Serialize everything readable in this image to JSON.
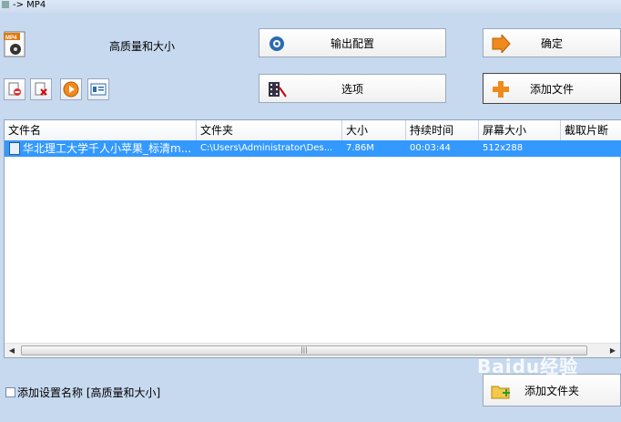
{
  "window": {
    "title": "-> MP4"
  },
  "profile": {
    "label": "高质量和大小",
    "icon": "mp4-format-icon"
  },
  "buttons": {
    "output_config": "输出配置",
    "ok": "确定",
    "options": "选项",
    "add_file": "添加文件",
    "add_folder": "添加文件夹"
  },
  "toolbar_icons": [
    "remove-icon",
    "clear-icon",
    "play-icon",
    "info-icon"
  ],
  "table": {
    "columns": [
      "文件名",
      "文件夹",
      "大小",
      "持续时间",
      "屏幕大小",
      "截取片断"
    ],
    "rows": [
      {
        "name": "华北理工大学千人小苹果_标清m...",
        "folder": "C:\\Users\\Administrator\\Des...",
        "size": "7.86M",
        "duration": "00:03:44",
        "screen": "512x288",
        "clip": ""
      }
    ]
  },
  "scrollbar": {
    "grip": "|||"
  },
  "options": {
    "add_setting_name": "添加设置名称 [高质量和大小]"
  },
  "watermark": {
    "text": "Baidu经验"
  },
  "colors": {
    "selection": "#3399ff",
    "background": "#c7d9ef"
  }
}
